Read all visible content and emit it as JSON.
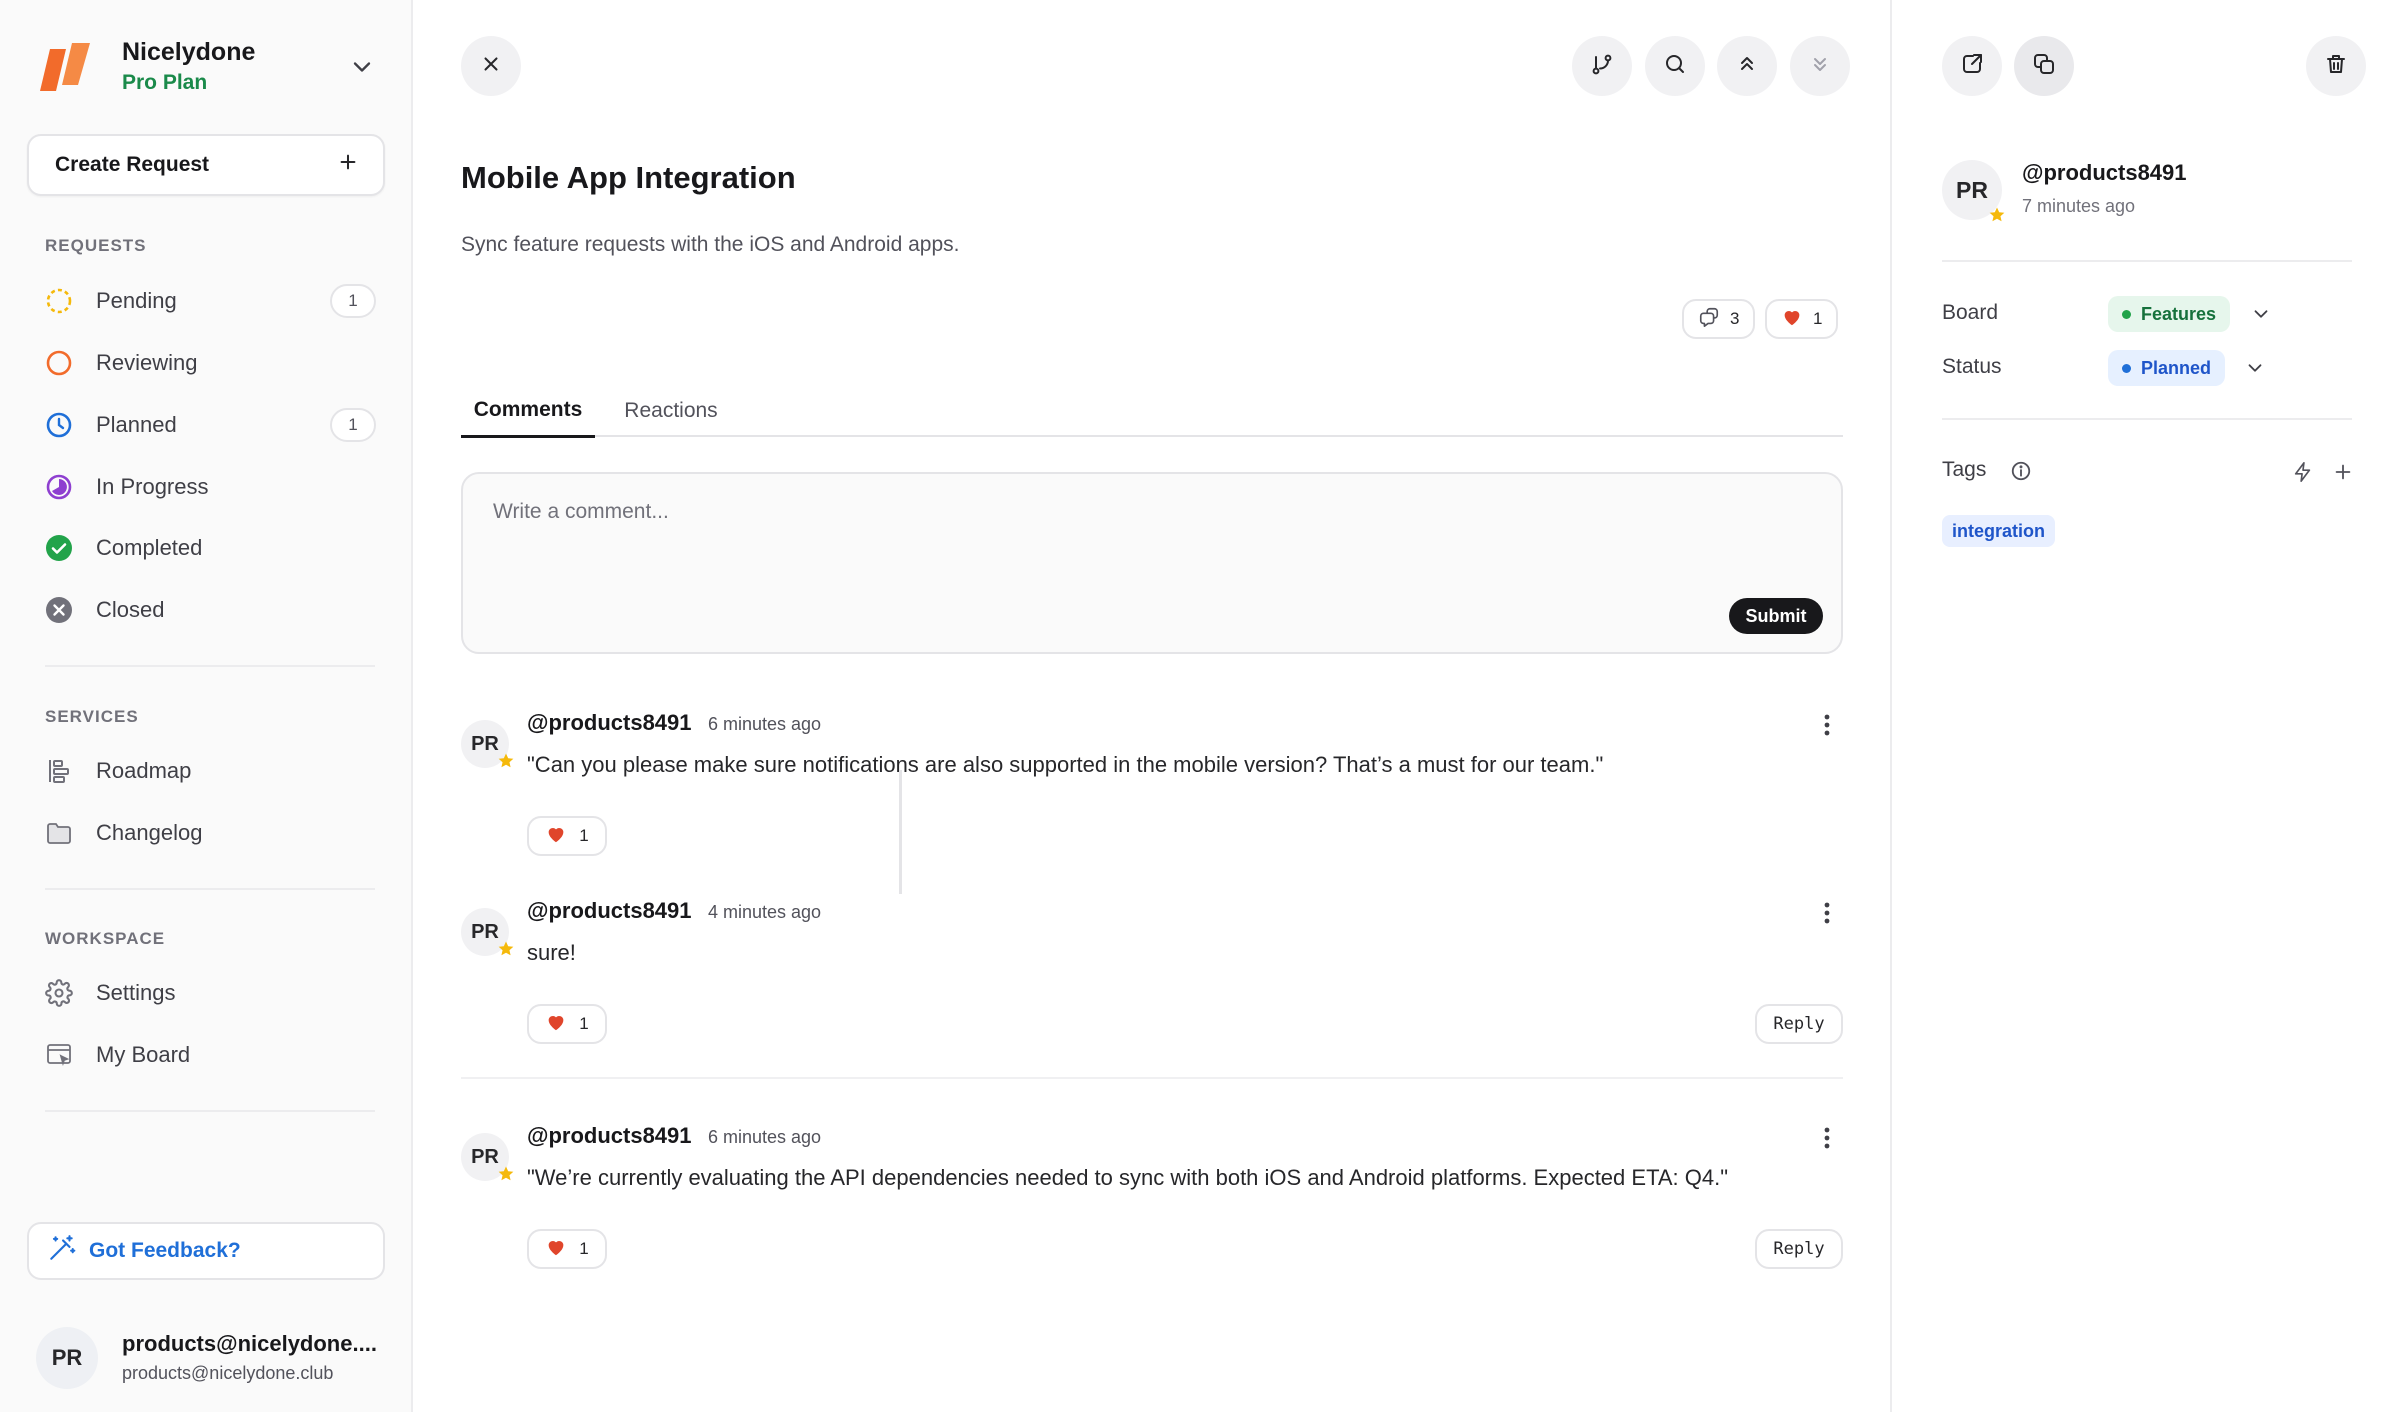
{
  "workspace": {
    "name": "Nicelydone",
    "plan": "Pro Plan"
  },
  "sidebar": {
    "create_label": "Create Request",
    "sections": {
      "requests": "REQUESTS",
      "services": "SERVICES",
      "workspace": "WORKSPACE"
    },
    "requests": [
      {
        "label": "Pending",
        "badge": "1",
        "icon": "pending-dashed-circle-icon"
      },
      {
        "label": "Reviewing",
        "badge": "",
        "icon": "reviewing-circle-icon"
      },
      {
        "label": "Planned",
        "badge": "1",
        "icon": "clock-icon"
      },
      {
        "label": "In Progress",
        "badge": "",
        "icon": "half-circle-icon"
      },
      {
        "label": "Completed",
        "badge": "",
        "icon": "check-circle-icon"
      },
      {
        "label": "Closed",
        "badge": "",
        "icon": "x-circle-icon"
      }
    ],
    "services": [
      {
        "label": "Roadmap",
        "icon": "roadmap-icon"
      },
      {
        "label": "Changelog",
        "icon": "folder-icon"
      }
    ],
    "workspace": [
      {
        "label": "Settings",
        "icon": "gear-icon"
      },
      {
        "label": "My Board",
        "icon": "board-icon"
      }
    ],
    "feedback_label": "Got Feedback?",
    "user": {
      "initials": "PR",
      "name": "products@nicelydone....",
      "email": "products@nicelydone.club"
    }
  },
  "request": {
    "title": "Mobile App Integration",
    "description": "Sync feature requests with the iOS and Android apps.",
    "comment_count": "3",
    "reaction_count": "1"
  },
  "tabs": [
    "Comments",
    "Reactions"
  ],
  "composer": {
    "placeholder": "Write a comment...",
    "submit_label": "Submit"
  },
  "comments": [
    {
      "initials": "PR",
      "author": "@products8491",
      "time": "6 minutes ago",
      "text": "\"Can you please make sure notifications are also supported in the mobile version? That’s a must for our team.\"",
      "reactions": "1",
      "reply": ""
    },
    {
      "initials": "PR",
      "author": "@products8491",
      "time": "4 minutes ago",
      "text": "sure!",
      "reactions": "1",
      "reply": "Reply"
    },
    {
      "initials": "PR",
      "author": "@products8491",
      "time": "6 minutes ago",
      "text": "\"We’re currently evaluating the API dependencies needed to sync with both iOS and Android platforms. Expected ETA: Q4.\"",
      "reactions": "1",
      "reply": "Reply"
    }
  ],
  "details": {
    "author_initials": "PR",
    "author": "@products8491",
    "time": "7 minutes ago",
    "board_label": "Board",
    "board_value": "Features",
    "status_label": "Status",
    "status_value": "Planned",
    "tags_label": "Tags",
    "tags": [
      "integration"
    ]
  },
  "colors": {
    "accent_green": "#1a8a4a",
    "accent_blue": "#1f6fd8",
    "logo_orange": "#f26b2b",
    "heart_red": "#e0452b",
    "star_yellow": "#f5b90b"
  }
}
